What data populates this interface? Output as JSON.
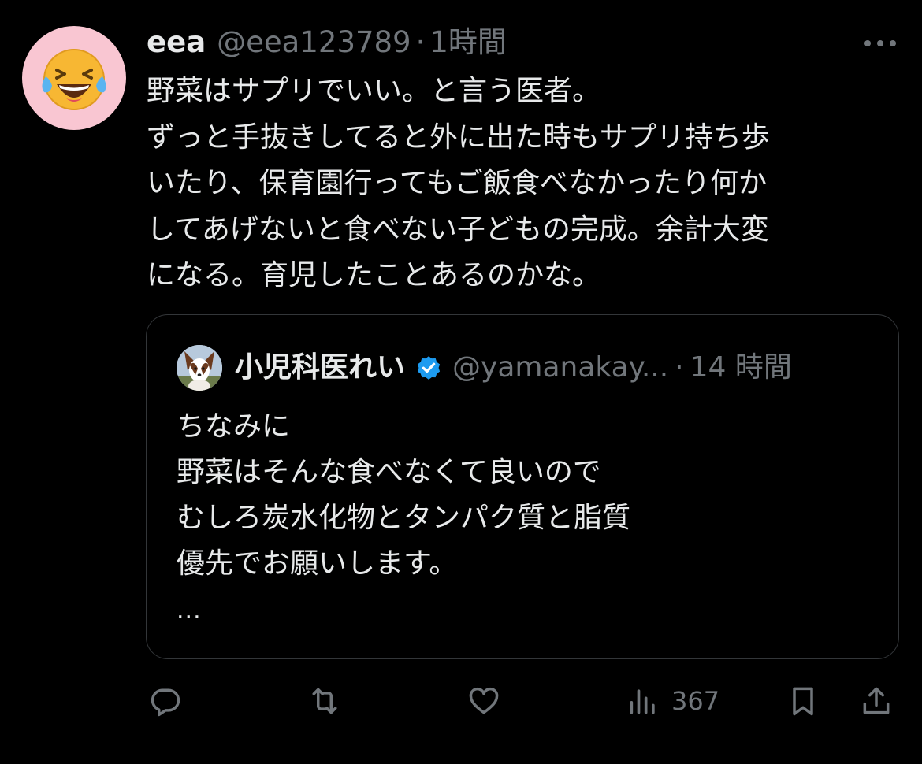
{
  "tweet": {
    "author_name": "eea",
    "author_handle": "@eea123789",
    "separator": "·",
    "timestamp": "1時間",
    "avatar_icon": "laughing-face-emoji",
    "text_lines": [
      "野菜はサプリでいい。と言う医者。",
      "ずっと手抜きしてると外に出た時もサプリ持ち歩",
      "いたり、保育園行ってもご飯食べなかったり何か",
      "してあげないと食べない子どもの完成。余計大変",
      "になる。育児したことあるのかな。"
    ]
  },
  "quote": {
    "author_name": "小児科医れい",
    "verified": true,
    "author_handle": "@yamanakay...",
    "separator": "·",
    "timestamp": "14 時間",
    "text_lines": [
      "ちなみに",
      "野菜はそんな食べなくて良いので",
      "むしろ炭水化物とタンパク質と脂質",
      "優先でお願いします。"
    ],
    "ellipsis": "..."
  },
  "actions": {
    "views_count": "367"
  },
  "colors": {
    "background": "#000000",
    "text": "#e7e9ea",
    "muted": "#71767b",
    "border": "#333639",
    "verified": "#1d9bf0",
    "avatar_bg": "#f9c6d2"
  }
}
